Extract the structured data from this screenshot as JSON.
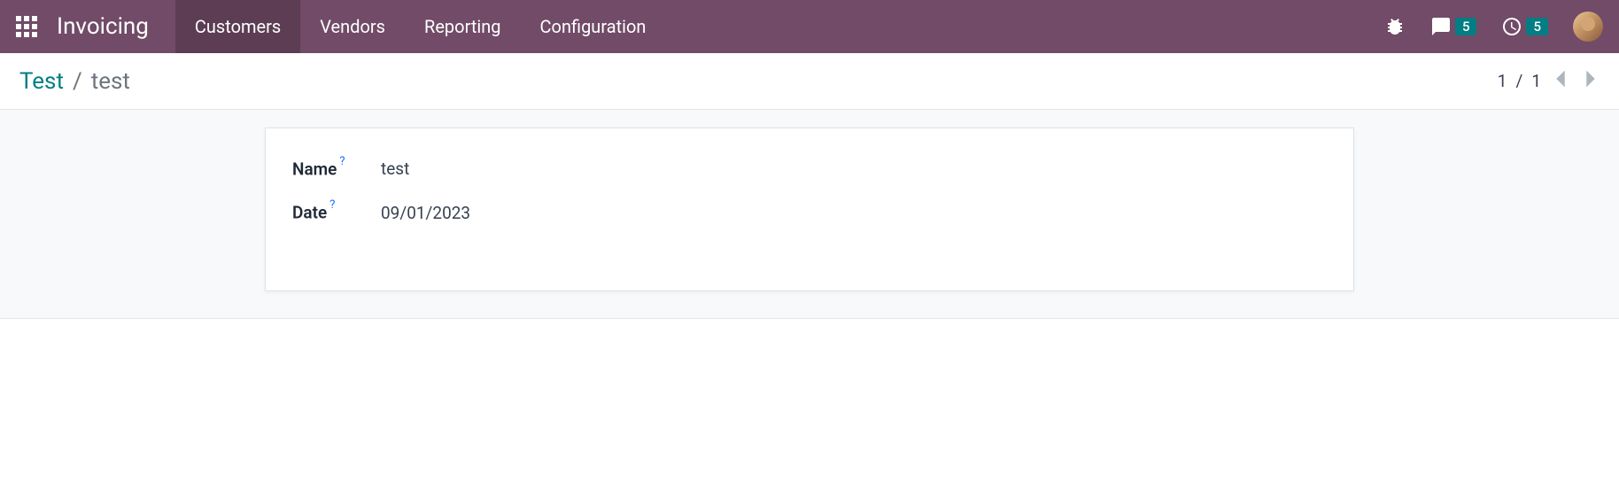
{
  "header": {
    "brand": "Invoicing",
    "menu": [
      {
        "label": "Customers",
        "active": true
      },
      {
        "label": "Vendors",
        "active": false
      },
      {
        "label": "Reporting",
        "active": false
      },
      {
        "label": "Configuration",
        "active": false
      }
    ],
    "messages_badge": "5",
    "activities_badge": "5"
  },
  "breadcrumb": {
    "parent": "Test",
    "separator": "/",
    "current": "test"
  },
  "pager": {
    "current": "1",
    "sep": "/",
    "total": "1"
  },
  "form": {
    "name_label": "Name",
    "name_value": "test",
    "date_label": "Date",
    "date_value": "09/01/2023",
    "help_mark": "?"
  }
}
